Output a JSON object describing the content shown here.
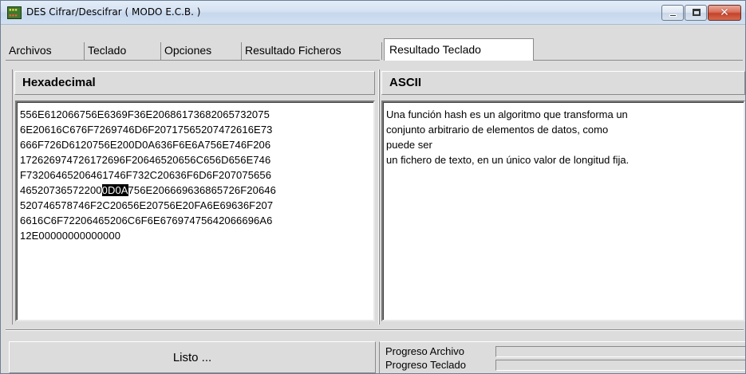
{
  "window": {
    "title": "DES Cifrar/Descifrar ( MODO E.C.B. )",
    "icon": "des-app-icon"
  },
  "tabs": [
    {
      "label": "Archivos",
      "active": false
    },
    {
      "label": "Teclado",
      "active": false
    },
    {
      "label": "Opciones",
      "active": false
    },
    {
      "label": "Resultado Ficheros",
      "active": false
    },
    {
      "label": "Resultado Teclado",
      "active": true
    }
  ],
  "hex_panel": {
    "header": "Hexadecimal",
    "lines": [
      "556E612066756E6369F36E20686173682065732075",
      "6E20616C676F7269746D6F20717565207472616E73",
      "666F726D6120756E200D0A636F6E6A756E746F206",
      "172626974726172696F20646520656C656D656E746",
      "F73206465206461746F732C20636F6D6F207075656",
      "46520736572200D0A756E206669636865726F20646",
      "520746578746F2C20656E20756E20FA6E69636F207",
      "6616C6F72206465206C6F6E67697475642066696A6",
      "12E00000000000000"
    ],
    "highlight": {
      "line": 5,
      "before": "46520736572200",
      "selected": "0D0A",
      "after": "756E206669636865726F20646"
    }
  },
  "ascii_panel": {
    "header": "ASCII",
    "lines": [
      "Una función hash es un algoritmo que transforma un",
      "conjunto arbitrario de elementos de datos, como",
      "puede ser",
      "un fichero de texto, en un único valor de longitud fija."
    ]
  },
  "status": {
    "message": "Listo ...",
    "progress_file_label": "Progreso Archivo",
    "progress_keyboard_label": "Progreso Teclado",
    "progress_file": 0,
    "progress_keyboard": 0
  },
  "colors": {
    "window_bg": "#dcdcdc",
    "selection_bg": "#000000",
    "close_button": "#c3422a"
  }
}
